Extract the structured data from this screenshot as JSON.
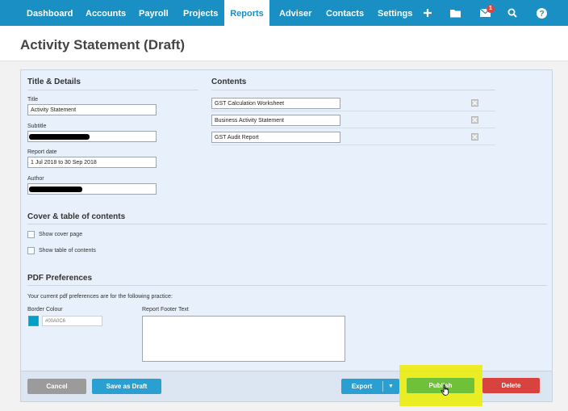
{
  "nav": {
    "items": [
      "Dashboard",
      "Accounts",
      "Payroll",
      "Projects",
      "Reports",
      "Adviser",
      "Contacts",
      "Settings"
    ],
    "active": "Reports",
    "mail_badge": "1",
    "icons": [
      "plus-icon",
      "folder-icon",
      "mail-icon",
      "search-icon",
      "help-icon"
    ]
  },
  "page": {
    "title": "Activity Statement (Draft)"
  },
  "details": {
    "heading": "Title & Details",
    "title_label": "Title",
    "title_value": "Activity Statement",
    "subtitle_label": "Subtitle",
    "report_date_label": "Report date",
    "report_date_value": "1 Jul 2018 to 30 Sep 2018",
    "author_label": "Author"
  },
  "contents": {
    "heading": "Contents",
    "items": [
      "GST Calculation Worksheet",
      "Business Activity Statement",
      "GST Audit Report"
    ]
  },
  "cover": {
    "heading": "Cover & table of contents",
    "show_cover": "Show cover page",
    "show_toc": "Show table of contents"
  },
  "pdf": {
    "heading": "PDF Preferences",
    "note": "Your current pdf preferences are for the following practice:",
    "border_label": "Border Colour",
    "border_value": "#00A0C6",
    "footer_label": "Report Footer Text"
  },
  "buttons": {
    "cancel": "Cancel",
    "save_draft": "Save as Draft",
    "export": "Export",
    "publish": "Publish",
    "delete": "Delete"
  },
  "colors": {
    "nav": "#1a8fc4",
    "accent": "#2aa0d2",
    "publish": "#6fc13a",
    "delete": "#d9433f",
    "highlight": "#ecec00"
  }
}
